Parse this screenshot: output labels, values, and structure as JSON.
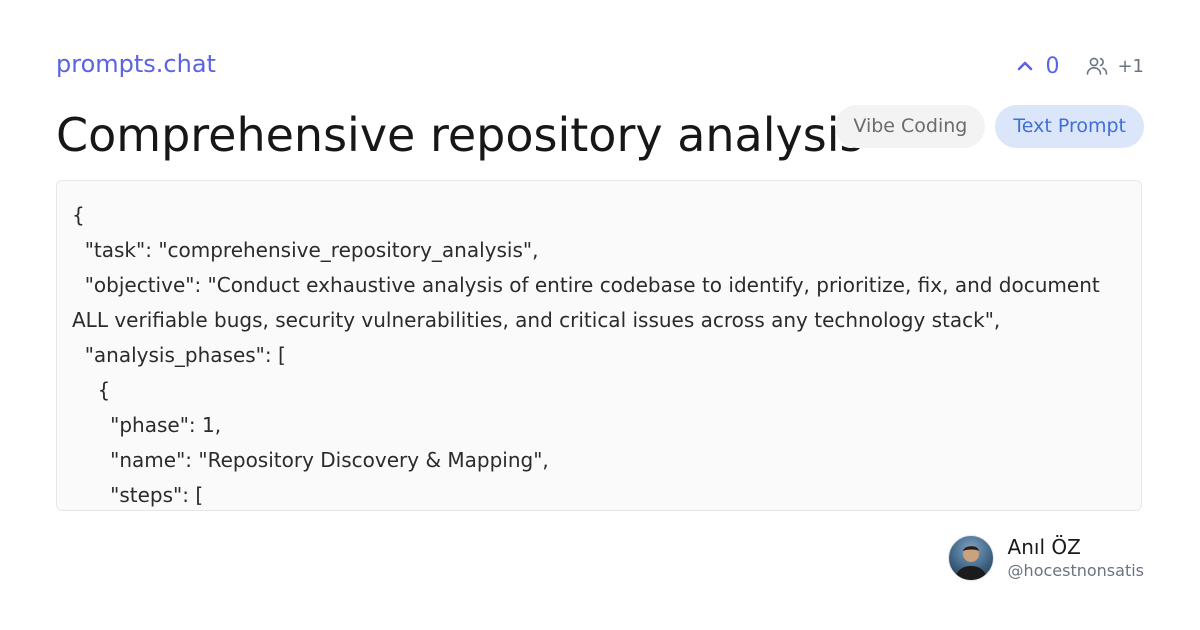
{
  "brand": {
    "name": "prompts.chat"
  },
  "stats": {
    "votes": "0",
    "contributors": "+1"
  },
  "prompt": {
    "title": "Comprehensive repository analysis",
    "tags": [
      "Vibe Coding",
      "Text Prompt"
    ],
    "content": "{\n  \"task\": \"comprehensive_repository_analysis\",\n  \"objective\": \"Conduct exhaustive analysis of entire codebase to identify, prioritize, fix, and document ALL verifiable bugs, security vulnerabilities, and critical issues across any technology stack\",\n  \"analysis_phases\": [\n    {\n      \"phase\": 1,\n      \"name\": \"Repository Discovery & Mapping\",\n      \"steps\": ["
  },
  "author": {
    "name": "Anıl ÖZ",
    "handle": "@hocestnonsatis"
  },
  "icons": {
    "upvote": "chevron-up-icon",
    "contributors": "users-icon"
  },
  "colors": {
    "accent": "#5b63e5",
    "tag_type_bg": "#dbe6fb",
    "tag_type_text": "#3f6fd8"
  }
}
